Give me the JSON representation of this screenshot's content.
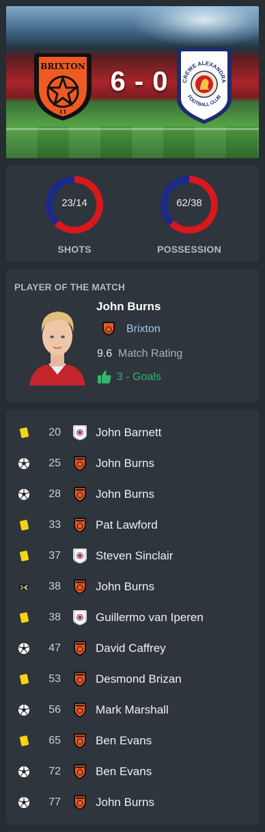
{
  "match": {
    "home_team": "Brixton",
    "away_team": "Crewe Alexandra",
    "home_badge_text": "BRIXTON",
    "home_badge_sub": "11",
    "away_badge_text_top": "CREWE ALEXANDRA",
    "away_badge_text_bottom": "FOOTBALL CLUB",
    "score": "6 - 0"
  },
  "stats": [
    {
      "label": "SHOTS",
      "value": "23/14",
      "home": 23,
      "away": 14
    },
    {
      "label": "POSSESSION",
      "value": "62/38",
      "home": 62,
      "away": 38
    }
  ],
  "colors": {
    "home": "#d7181c",
    "away": "#1b2a8a",
    "goals_green": "#37b56e",
    "club_link": "#9ec8ee"
  },
  "player_of_match": {
    "title": "PLAYER OF THE MATCH",
    "name": "John Burns",
    "club": "Brixton",
    "rating": "9.6",
    "rating_label": "Match Rating",
    "achievement": "3 - Goals"
  },
  "events": [
    {
      "type": "yellow-card",
      "minute": "20",
      "team": "away",
      "player": "John Barnett"
    },
    {
      "type": "goal",
      "minute": "25",
      "team": "home",
      "player": "John Burns"
    },
    {
      "type": "goal",
      "minute": "28",
      "team": "home",
      "player": "John Burns"
    },
    {
      "type": "yellow-card",
      "minute": "33",
      "team": "home",
      "player": "Pat Lawford"
    },
    {
      "type": "yellow-card",
      "minute": "37",
      "team": "away",
      "player": "Steven Sinclair"
    },
    {
      "type": "substitution",
      "minute": "38",
      "team": "home",
      "player": "John Burns"
    },
    {
      "type": "yellow-card",
      "minute": "38",
      "team": "away",
      "player": "Guillermo van Iperen"
    },
    {
      "type": "goal",
      "minute": "47",
      "team": "home",
      "player": "David Caffrey"
    },
    {
      "type": "yellow-card",
      "minute": "53",
      "team": "home",
      "player": "Desmond Brizan"
    },
    {
      "type": "goal",
      "minute": "56",
      "team": "home",
      "player": "Mark Marshall"
    },
    {
      "type": "yellow-card",
      "minute": "65",
      "team": "home",
      "player": "Ben Evans"
    },
    {
      "type": "goal",
      "minute": "72",
      "team": "home",
      "player": "Ben Evans"
    },
    {
      "type": "goal",
      "minute": "77",
      "team": "home",
      "player": "John Burns"
    }
  ]
}
